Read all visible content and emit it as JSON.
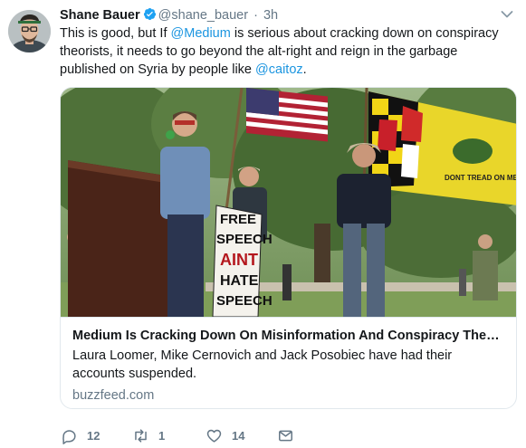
{
  "tweet": {
    "author": {
      "name": "Shane Bauer",
      "handle": "@shane_bauer",
      "verified": true,
      "avatar_icon": "avatar-photo"
    },
    "separator": "·",
    "time": "3h",
    "text": {
      "part1": "This is good, but If ",
      "mention1": "@Medium",
      "part2": " is serious about cracking down on conspiracy theorists, it needs to go beyond the alt-right and reign in the garbage published on Syria by people like ",
      "mention2": "@caitoz",
      "part3": "."
    },
    "card": {
      "image_icon": "protest-rally-photo",
      "sign_text": [
        "FREE",
        "SPEECH",
        "AINT",
        "HATE",
        "SPEECH"
      ],
      "flag_text": "DONT TREAD ON ME",
      "title": "Medium Is Cracking Down On Misinformation And Conspiracy Theori...",
      "description": "Laura Loomer, Mike Cernovich and Jack Posobiec have had their accounts suspended.",
      "domain": "buzzfeed.com"
    },
    "actions": {
      "reply_count": "12",
      "retweet_count": "1",
      "like_count": "14"
    }
  },
  "colors": {
    "link": "#1b95e0",
    "secondary_text": "#657786",
    "verified_badge": "#1da1f2",
    "border": "#e1e8ed"
  }
}
